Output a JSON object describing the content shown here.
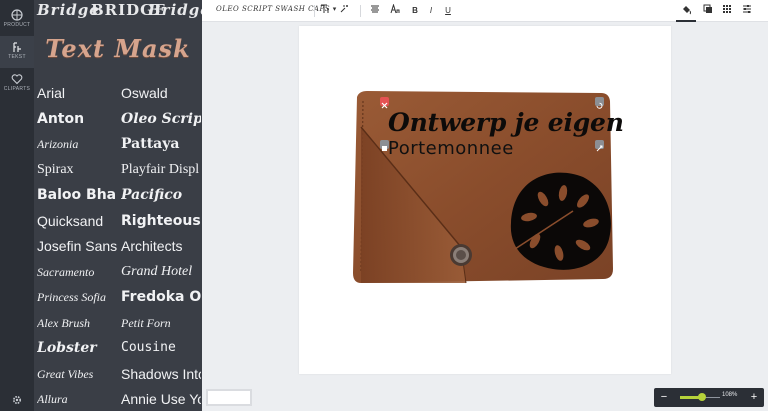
{
  "rail": {
    "items": [
      {
        "label": "PRODUCT",
        "icon": "product-icon"
      },
      {
        "label": "TEKST",
        "icon": "text-icon"
      },
      {
        "label": "CLIPARTS",
        "icon": "heart-icon"
      }
    ],
    "settings_icon": "gear-icon"
  },
  "panel": {
    "header_samples": [
      "Bridge",
      "BRIDGE",
      "Bridge"
    ],
    "title": "Text Mask",
    "fonts": [
      {
        "name": "Arial",
        "family": "sans"
      },
      {
        "name": "Oswald",
        "family": "sans"
      },
      {
        "name": "Anton",
        "family": "sans-bold"
      },
      {
        "name": "Oleo Script Sw",
        "family": "serif-bold-italic"
      },
      {
        "name": "Arizonia",
        "family": "script"
      },
      {
        "name": "Pattaya",
        "family": "serif-bold"
      },
      {
        "name": "Spirax",
        "family": "serif"
      },
      {
        "name": "Playfair Displ",
        "family": "serif"
      },
      {
        "name": "Baloo Bhain",
        "family": "sans-bold"
      },
      {
        "name": "Pacifico",
        "family": "serif-bold-italic"
      },
      {
        "name": "Quicksand",
        "family": "sans"
      },
      {
        "name": "Righteous",
        "family": "sans-bold"
      },
      {
        "name": "Josefin Sans",
        "family": "sans"
      },
      {
        "name": "Architects",
        "family": "sans"
      },
      {
        "name": "Sacramento",
        "family": "script"
      },
      {
        "name": "Grand Hotel",
        "family": "serif-italic"
      },
      {
        "name": "Princess Sofia",
        "family": "script"
      },
      {
        "name": "Fredoka On",
        "family": "sans-bold"
      },
      {
        "name": "Alex Brush",
        "family": "script"
      },
      {
        "name": "Petit Forn",
        "family": "script"
      },
      {
        "name": "Lobster",
        "family": "serif-bold-italic"
      },
      {
        "name": "Cousine",
        "family": "mono"
      },
      {
        "name": "Great Vibes",
        "family": "script"
      },
      {
        "name": "Shadows Into",
        "family": "sans"
      },
      {
        "name": "Allura",
        "family": "script"
      },
      {
        "name": "Annie Use Your",
        "family": "sans"
      }
    ]
  },
  "toolbar": {
    "font_label": "OLEO SCRIPT SWASH CAPS",
    "dropdown_caret": "▾",
    "icons": {
      "text_size": "text-size-icon",
      "text_effect": "text-effect-icon",
      "align": "align-icon",
      "font_case": "font-case-icon",
      "bold": "B",
      "italic": "I",
      "underline": "U",
      "fill": "fill-bucket-icon",
      "layers": "layers-icon",
      "grid": "grid-icon",
      "adjust": "sliders-icon"
    }
  },
  "design": {
    "line1": "Ontwerp je eigen",
    "line2": "Portemonnee",
    "leather_color": "#8c4f2e",
    "ink_color": "#0d0b0a"
  },
  "zoom": {
    "minus": "−",
    "plus": "+",
    "value_text": "108%",
    "level": 0.54,
    "accent": "#b6d23a"
  }
}
